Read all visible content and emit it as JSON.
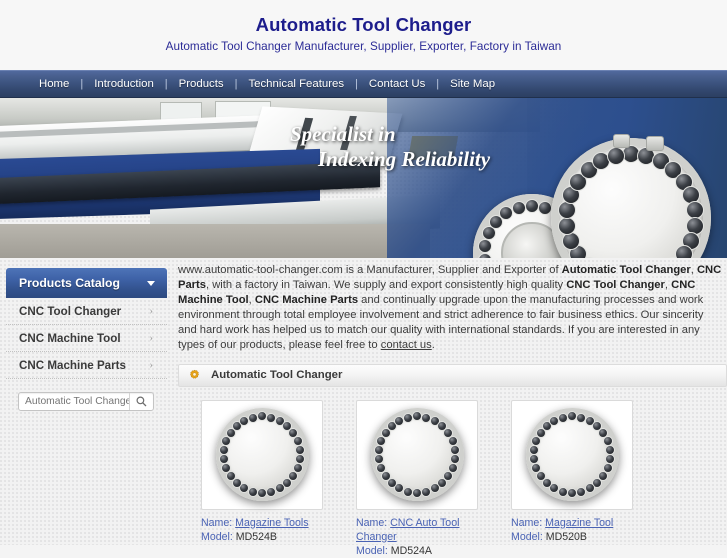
{
  "header": {
    "title": "Automatic Tool Changer",
    "subtitle": "Automatic Tool Changer Manufacturer, Supplier, Exporter, Factory in Taiwan"
  },
  "nav": {
    "separator": "|",
    "items": [
      {
        "label": "Home"
      },
      {
        "label": "Introduction"
      },
      {
        "label": "Products"
      },
      {
        "label": "Technical Features"
      },
      {
        "label": "Contact Us"
      },
      {
        "label": "Site Map"
      }
    ]
  },
  "banner": {
    "tagline_line1": "Specialist in",
    "tagline_line2": "Indexing Reliability"
  },
  "sidebar": {
    "catalog_title": "Products Catalog",
    "caret_icon": "chevron-down-icon",
    "items": [
      {
        "label": "CNC Tool Changer",
        "chevron": "›"
      },
      {
        "label": "CNC Machine Tool",
        "chevron": "›"
      },
      {
        "label": "CNC Machine Parts",
        "chevron": "›"
      }
    ],
    "search": {
      "placeholder": "Automatic Tool Changer",
      "value": "",
      "icon": "search-icon"
    }
  },
  "main": {
    "intro": {
      "p1_a": "www.automatic-tool-changer.com is a Manufacturer, Supplier and Exporter of ",
      "b1": "Automatic Tool Changer",
      "p1_b": ", ",
      "b2": "CNC Parts",
      "p1_c": ", with a factory in Taiwan. We supply and export consistently high quality ",
      "b3": "CNC Tool Changer",
      "p1_d": ", ",
      "b4": "CNC Machine Tool",
      "p1_e": ", ",
      "b5": "CNC Machine Parts",
      "p1_f": " and continually upgrade upon the manufacturing processes and work environment through total employee involvement and strict adherence to fair business ethics. Our sincerity and hard work has helped us to match our quality with international standards. If you are interested in any types of our products, please feel free to ",
      "link": "contact us",
      "p1_g": "."
    },
    "section": {
      "icon": "gear-icon",
      "title": "Automatic Tool Changer"
    },
    "products": [
      {
        "name_label": "Name:",
        "name": "Magazine Tools",
        "model_label": "Model:",
        "model": "MD524B",
        "image": "tool-magazine-disc-image"
      },
      {
        "name_label": "Name:",
        "name": "CNC Auto Tool Changer",
        "model_label": "Model:",
        "model": "MD524A",
        "image": "tool-magazine-disc-image"
      },
      {
        "name_label": "Name:",
        "name": "Magazine Tool",
        "model_label": "Model:",
        "model": "MD520B",
        "image": "tool-magazine-disc-image"
      }
    ]
  },
  "colors": {
    "nav_blue": "#3d5480",
    "title_navy": "#1d1d8c",
    "link_blue": "#4a63b4",
    "gear_gold": "#e8a317"
  }
}
